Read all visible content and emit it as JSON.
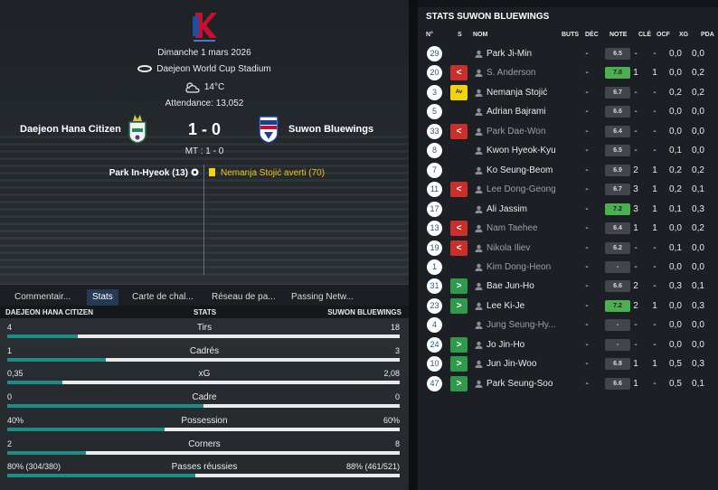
{
  "match": {
    "date": "Dimanche 1 mars 2026",
    "stadium": "Daejeon World Cup Stadium",
    "weather": "14°C",
    "attendance": "Attendance: 13,052",
    "home_team": "Daejeon Hana Citizen",
    "away_team": "Suwon Bluewings",
    "score": "1 - 0",
    "half_time": "MT : 1 - 0",
    "event_home": "Park In-Hyeok (13)",
    "event_away": "Nemanja Stojić averti (70)"
  },
  "tabs": [
    {
      "label": "Commentair..."
    },
    {
      "label": "Stats"
    },
    {
      "label": "Carte de chal..."
    },
    {
      "label": "Réseau de pa..."
    },
    {
      "label": "Passing Netw..."
    }
  ],
  "stats": {
    "home_header": "DAEJEON HANA CITIZEN",
    "center_header": "STATS",
    "away_header": "SUWON BLUEWINGS",
    "rows": [
      {
        "name": "Tirs",
        "home": "4",
        "away": "18",
        "home_share": 0.18
      },
      {
        "name": "Cadrés",
        "home": "1",
        "away": "3",
        "home_share": 0.25
      },
      {
        "name": "xG",
        "home": "0,35",
        "away": "2,08",
        "home_share": 0.14
      },
      {
        "name": "Cadre",
        "home": "0",
        "away": "0",
        "home_share": 0.5
      },
      {
        "name": "Possession",
        "home": "40%",
        "away": "60%",
        "home_share": 0.4
      },
      {
        "name": "Corners",
        "home": "2",
        "away": "8",
        "home_share": 0.2
      },
      {
        "name": "Passes réussies",
        "home": "80% (304/380)",
        "away": "88% (461/521)",
        "home_share": 0.48
      }
    ]
  },
  "right": {
    "title": "STATS SUWON BLUEWINGS",
    "columns": {
      "num": "N°",
      "s": "S",
      "nom": "NOM",
      "buts": "BUTS",
      "dec": "DÉC",
      "note": "NOTE",
      "cle": "CLÉ",
      "ocf": "OCF",
      "xg": "XG",
      "pda": "PDA"
    },
    "players": [
      {
        "num": "29",
        "sub": "",
        "name": "Park Ji-Min",
        "dim": false,
        "buts": "",
        "dec": "-",
        "note": "6.5",
        "good": false,
        "cle": "-",
        "ocf": "-",
        "xg": "0,0",
        "pda": "0,0"
      },
      {
        "num": "20",
        "sub": "out",
        "name": "S. Anderson",
        "dim": true,
        "buts": "",
        "dec": "-",
        "note": "7.0",
        "good": true,
        "cle": "1",
        "ocf": "1",
        "xg": "0,0",
        "pda": "0,2"
      },
      {
        "num": "3",
        "sub": "yc",
        "name": "Nemanja Stojić",
        "dim": false,
        "buts": "",
        "dec": "-",
        "note": "6.7",
        "good": false,
        "cle": "-",
        "ocf": "-",
        "xg": "0,2",
        "pda": "0,2"
      },
      {
        "num": "5",
        "sub": "",
        "name": "Adrian Bajrami",
        "dim": false,
        "buts": "",
        "dec": "-",
        "note": "6.6",
        "good": false,
        "cle": "-",
        "ocf": "-",
        "xg": "0,0",
        "pda": "0,0"
      },
      {
        "num": "33",
        "sub": "out",
        "name": "Park Dae-Won",
        "dim": true,
        "buts": "",
        "dec": "-",
        "note": "6.4",
        "good": false,
        "cle": "-",
        "ocf": "-",
        "xg": "0,0",
        "pda": "0,0"
      },
      {
        "num": "8",
        "sub": "",
        "name": "Kwon Hyeok-Kyu",
        "dim": false,
        "buts": "",
        "dec": "-",
        "note": "6.5",
        "good": false,
        "cle": "-",
        "ocf": "-",
        "xg": "0,1",
        "pda": "0,0"
      },
      {
        "num": "7",
        "sub": "",
        "name": "Ko Seung-Beom",
        "dim": false,
        "buts": "",
        "dec": "-",
        "note": "6.9",
        "good": false,
        "cle": "2",
        "ocf": "1",
        "xg": "0,2",
        "pda": "0,2"
      },
      {
        "num": "11",
        "sub": "out",
        "name": "Lee Dong-Geong",
        "dim": true,
        "buts": "",
        "dec": "-",
        "note": "6.7",
        "good": false,
        "cle": "3",
        "ocf": "1",
        "xg": "0,2",
        "pda": "0,1"
      },
      {
        "num": "17",
        "sub": "",
        "name": "Ali Jassim",
        "dim": false,
        "buts": "",
        "dec": "-",
        "note": "7.2",
        "good": true,
        "cle": "3",
        "ocf": "1",
        "xg": "0,1",
        "pda": "0,3"
      },
      {
        "num": "13",
        "sub": "out",
        "name": "Nam Taehee",
        "dim": true,
        "buts": "",
        "dec": "-",
        "note": "6.4",
        "good": false,
        "cle": "1",
        "ocf": "1",
        "xg": "0,0",
        "pda": "0,2"
      },
      {
        "num": "19",
        "sub": "out",
        "name": "Nikola Iliev",
        "dim": true,
        "buts": "",
        "dec": "-",
        "note": "6.2",
        "good": false,
        "cle": "-",
        "ocf": "-",
        "xg": "0,1",
        "pda": "0,0"
      },
      {
        "num": "1",
        "sub": "",
        "name": "Kim Dong-Heon",
        "dim": true,
        "buts": "",
        "dec": "-",
        "note": "-",
        "good": false,
        "cle": "-",
        "ocf": "-",
        "xg": "0,0",
        "pda": "0,0"
      },
      {
        "num": "31",
        "sub": "in",
        "name": "Bae Jun-Ho",
        "dim": false,
        "buts": "",
        "dec": "-",
        "note": "6.6",
        "good": false,
        "cle": "2",
        "ocf": "-",
        "xg": "0,3",
        "pda": "0,1"
      },
      {
        "num": "23",
        "sub": "in",
        "name": "Lee Ki-Je",
        "dim": false,
        "buts": "",
        "dec": "-",
        "note": "7.2",
        "good": true,
        "cle": "2",
        "ocf": "1",
        "xg": "0,0",
        "pda": "0,3"
      },
      {
        "num": "4",
        "sub": "",
        "name": "Jung Seung-Hy...",
        "dim": true,
        "buts": "",
        "dec": "-",
        "note": "-",
        "good": false,
        "cle": "-",
        "ocf": "-",
        "xg": "0,0",
        "pda": "0,0"
      },
      {
        "num": "24",
        "sub": "in",
        "name": "Jo Jin-Ho",
        "dim": false,
        "buts": "",
        "dec": "-",
        "note": "-",
        "good": false,
        "cle": "-",
        "ocf": "-",
        "xg": "0,0",
        "pda": "0,0"
      },
      {
        "num": "10",
        "sub": "in",
        "name": "Jun Jin-Woo",
        "dim": false,
        "buts": "",
        "dec": "-",
        "note": "6.8",
        "good": false,
        "cle": "1",
        "ocf": "1",
        "xg": "0,5",
        "pda": "0,3"
      },
      {
        "num": "47",
        "sub": "in",
        "name": "Park Seung-Soo",
        "dim": false,
        "buts": "",
        "dec": "-",
        "note": "6.6",
        "good": false,
        "cle": "1",
        "ocf": "-",
        "xg": "0,5",
        "pda": "0,1"
      }
    ]
  },
  "colors": {
    "accent": "#1d8c84",
    "good_rating": "#4caf50",
    "sub_out": "#c9302c",
    "sub_in": "#2f9a4b",
    "yellow_card": "#f5d30b"
  }
}
